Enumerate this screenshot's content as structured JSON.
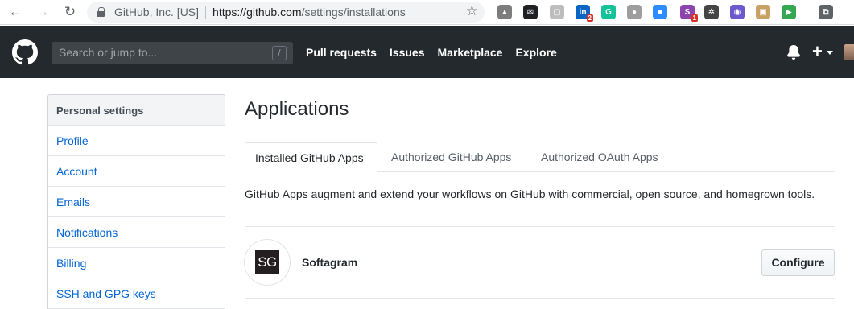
{
  "browser": {
    "site_identity": "GitHub, Inc. [US]",
    "url_host": "https://github.com",
    "url_path": "/settings/installations",
    "extensions": [
      {
        "name": "drive-icon",
        "color": "#7d7d7d",
        "glyph": "▲"
      },
      {
        "name": "mail-icon",
        "color": "#202124",
        "glyph": "✉"
      },
      {
        "name": "chat-icon",
        "color": "#bdbdbd",
        "glyph": "▢"
      },
      {
        "name": "linkedin-icon",
        "color": "#0a66c2",
        "glyph": "in",
        "badge": "2"
      },
      {
        "name": "grammarly-icon",
        "color": "#15c39a",
        "glyph": "G"
      },
      {
        "name": "circle-icon",
        "color": "#9e9e9e",
        "glyph": "●"
      },
      {
        "name": "zoom-icon",
        "color": "#2d8cff",
        "glyph": "■"
      },
      {
        "name": "s-ext-icon",
        "color": "#8e44ad",
        "glyph": "S",
        "badge": "1"
      },
      {
        "name": "openai-icon",
        "color": "#444444",
        "glyph": "✲"
      },
      {
        "name": "owl-icon",
        "color": "#6a5acd",
        "glyph": "◉"
      },
      {
        "name": "box-icon",
        "color": "#c8a165",
        "glyph": "▣"
      },
      {
        "name": "play-icon",
        "color": "#34a853",
        "glyph": "▶"
      },
      {
        "name": "cast-icon",
        "color": "#5f6368",
        "glyph": "⧉"
      }
    ]
  },
  "header": {
    "search_placeholder": "Search or jump to...",
    "search_key": "/",
    "nav": [
      "Pull requests",
      "Issues",
      "Marketplace",
      "Explore"
    ],
    "plus": "+"
  },
  "sidebar": {
    "heading": "Personal settings",
    "items": [
      "Profile",
      "Account",
      "Emails",
      "Notifications",
      "Billing",
      "SSH and GPG keys"
    ]
  },
  "main": {
    "title": "Applications",
    "tabs": [
      "Installed GitHub Apps",
      "Authorized GitHub Apps",
      "Authorized OAuth Apps"
    ],
    "selected_tab": "Installed GitHub Apps",
    "description": "GitHub Apps augment and extend your workflows on GitHub with commercial, open source, and homegrown tools.",
    "apps": [
      {
        "logo_text": "SG",
        "name": "Softagram",
        "action": "Configure"
      }
    ]
  },
  "colors": {
    "header_bg": "#24292e",
    "link": "#0366d6",
    "border": "#e1e4e8"
  }
}
